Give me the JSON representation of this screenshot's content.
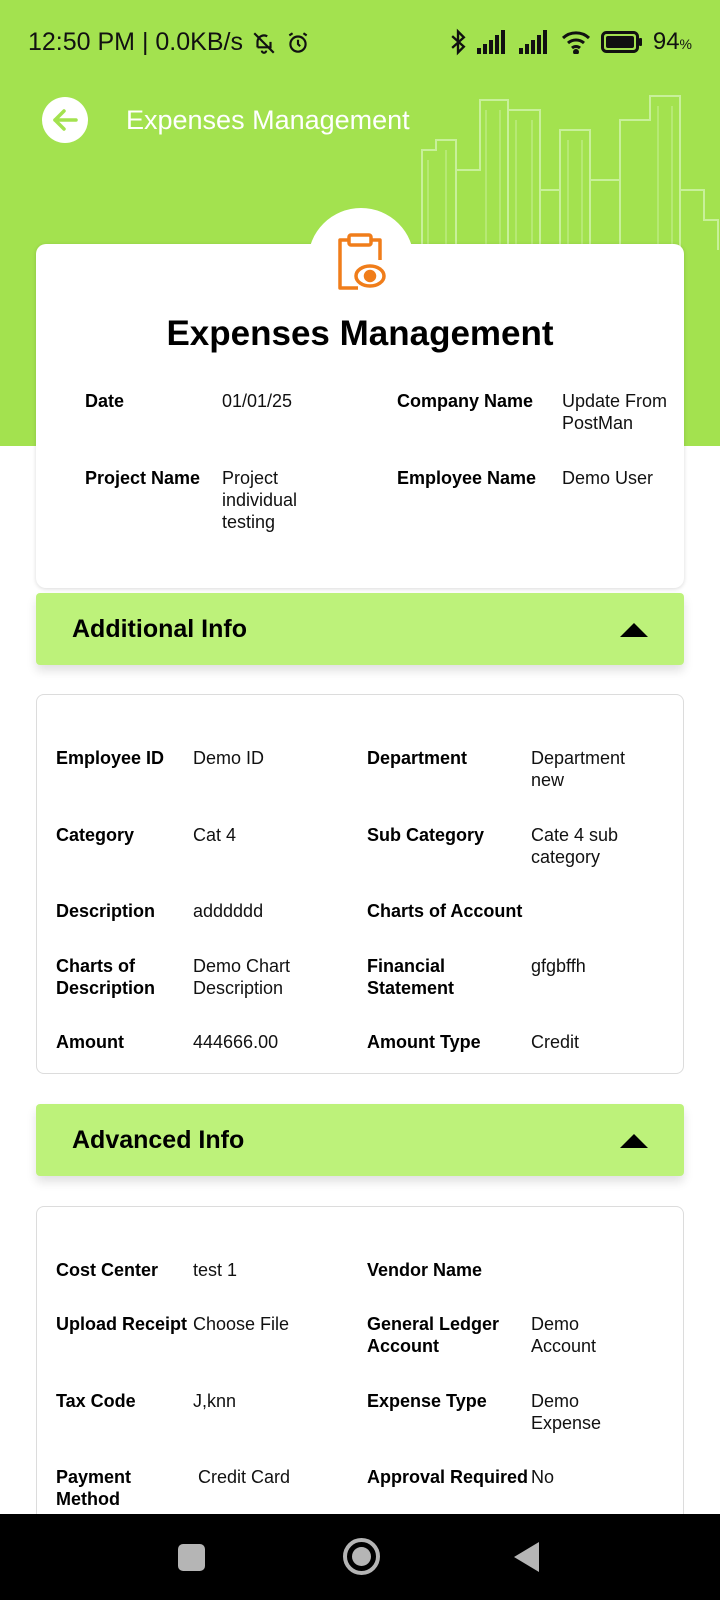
{
  "status_bar": {
    "time": "12:50 PM | 0.0KB/s",
    "battery": "94",
    "battery_unit": "%"
  },
  "header": {
    "title": "Expenses Management"
  },
  "card": {
    "title": "Expenses Management",
    "fields": [
      {
        "label": "Date",
        "value": "01/01/25"
      },
      {
        "label": "Company Name",
        "value": "Update From PostMan"
      },
      {
        "label": "Project Name",
        "value": "Project individual testing"
      },
      {
        "label": "Employee Name",
        "value": "Demo User"
      }
    ]
  },
  "additional_info": {
    "title": "Additional Info",
    "fields": [
      {
        "label": "Employee ID",
        "value": "Demo ID"
      },
      {
        "label": "Department",
        "value": "Department new"
      },
      {
        "label": "Category",
        "value": "Cat 4"
      },
      {
        "label": "Sub Category",
        "value": "Cate 4 sub category"
      },
      {
        "label": "Description",
        "value": "adddddd"
      },
      {
        "label": "Charts of Account",
        "value": ""
      },
      {
        "label": "Charts of Description",
        "value": "Demo Chart Description"
      },
      {
        "label": "Financial Statement",
        "value": "gfgbffh"
      },
      {
        "label": "Amount",
        "value": "444666.00"
      },
      {
        "label": "Amount Type",
        "value": "Credit"
      }
    ]
  },
  "advanced_info": {
    "title": "Advanced Info",
    "fields": [
      {
        "label": "Cost Center",
        "value": "test 1"
      },
      {
        "label": "Vendor Name",
        "value": ""
      },
      {
        "label": "Upload Receipt",
        "value": "Choose File"
      },
      {
        "label": "General Ledger Account",
        "value": "Demo Account"
      },
      {
        "label": "Tax Code",
        "value": "J,knn"
      },
      {
        "label": "Expense Type",
        "value": "Demo Expense"
      },
      {
        "label": "Payment Method",
        "value": "Credit Card"
      },
      {
        "label": "Approval Required",
        "value": "No"
      }
    ]
  },
  "colors": {
    "header_green": "#a3e24f",
    "section_green": "#bdf27a",
    "icon_orange": "#f07d1a"
  },
  "icons": [
    "back-arrow-icon",
    "clipboard-eye-icon",
    "collapse-caret-icon",
    "bluetooth-icon",
    "signal-icon",
    "wifi-icon",
    "battery-icon",
    "mute-bell-icon",
    "alarm-icon"
  ]
}
